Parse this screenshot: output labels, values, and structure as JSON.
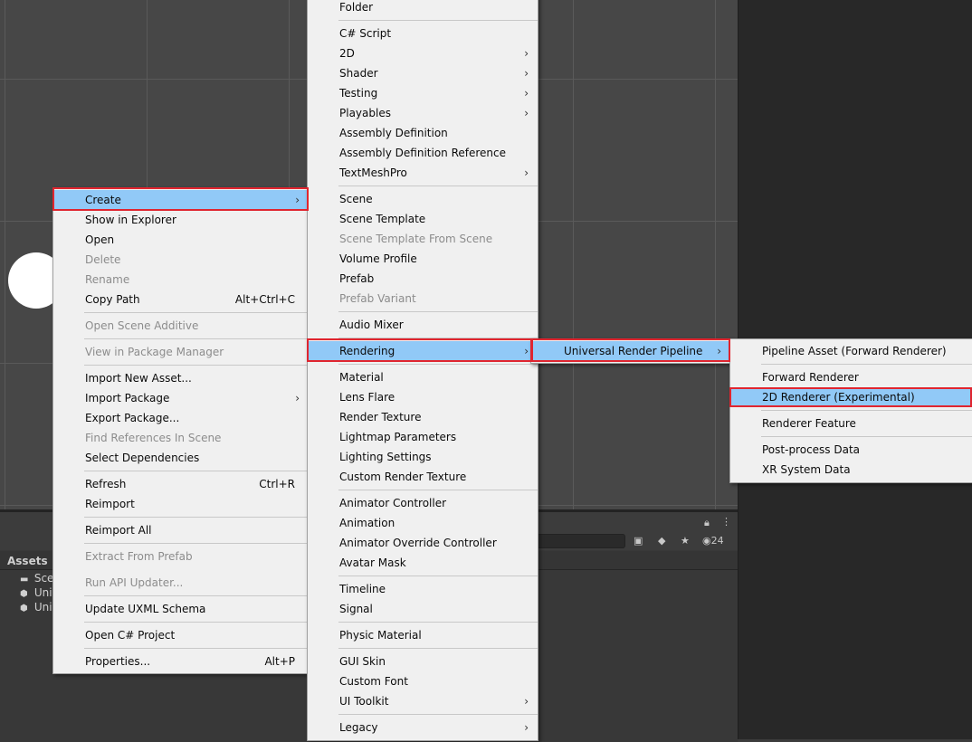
{
  "project_panel": {
    "assets_label": "Assets",
    "hidden_count": "24",
    "tree_items": [
      {
        "label": "Sce",
        "icon": "folder-icon"
      },
      {
        "label": "Uni",
        "icon": "asset-icon"
      },
      {
        "label": "Uni",
        "icon": "asset-icon"
      }
    ]
  },
  "context_menu": {
    "items": [
      {
        "label": "Create",
        "submenu": true,
        "highlighted": true
      },
      {
        "label": "Show in Explorer"
      },
      {
        "label": "Open"
      },
      {
        "label": "Delete",
        "disabled": true
      },
      {
        "label": "Rename",
        "disabled": true
      },
      {
        "label": "Copy Path",
        "shortcut": "Alt+Ctrl+C"
      },
      {
        "label": "Open Scene Additive",
        "disabled": true
      },
      {
        "label": "View in Package Manager",
        "disabled": true
      },
      {
        "label": "Import New Asset..."
      },
      {
        "label": "Import Package",
        "submenu": true
      },
      {
        "label": "Export Package..."
      },
      {
        "label": "Find References In Scene",
        "disabled": true
      },
      {
        "label": "Select Dependencies"
      },
      {
        "label": "Refresh",
        "shortcut": "Ctrl+R"
      },
      {
        "label": "Reimport"
      },
      {
        "label": "Reimport All"
      },
      {
        "label": "Extract From Prefab",
        "disabled": true
      },
      {
        "label": "Run API Updater...",
        "disabled": true
      },
      {
        "label": "Update UXML Schema"
      },
      {
        "label": "Open C# Project"
      },
      {
        "label": "Properties...",
        "shortcut": "Alt+P"
      }
    ]
  },
  "create_menu": {
    "items": [
      {
        "label": "Folder"
      },
      {
        "label": "C# Script"
      },
      {
        "label": "2D",
        "submenu": true
      },
      {
        "label": "Shader",
        "submenu": true
      },
      {
        "label": "Testing",
        "submenu": true
      },
      {
        "label": "Playables",
        "submenu": true
      },
      {
        "label": "Assembly Definition"
      },
      {
        "label": "Assembly Definition Reference"
      },
      {
        "label": "TextMeshPro",
        "submenu": true
      },
      {
        "label": "Scene"
      },
      {
        "label": "Scene Template"
      },
      {
        "label": "Scene Template From Scene",
        "disabled": true
      },
      {
        "label": "Volume Profile"
      },
      {
        "label": "Prefab"
      },
      {
        "label": "Prefab Variant",
        "disabled": true
      },
      {
        "label": "Audio Mixer"
      },
      {
        "label": "Rendering",
        "submenu": true,
        "highlighted": true
      },
      {
        "label": "Material"
      },
      {
        "label": "Lens Flare"
      },
      {
        "label": "Render Texture"
      },
      {
        "label": "Lightmap Parameters"
      },
      {
        "label": "Lighting Settings"
      },
      {
        "label": "Custom Render Texture"
      },
      {
        "label": "Animator Controller"
      },
      {
        "label": "Animation"
      },
      {
        "label": "Animator Override Controller"
      },
      {
        "label": "Avatar Mask"
      },
      {
        "label": "Timeline"
      },
      {
        "label": "Signal"
      },
      {
        "label": "Physic Material"
      },
      {
        "label": "GUI Skin"
      },
      {
        "label": "Custom Font"
      },
      {
        "label": "UI Toolkit",
        "submenu": true
      },
      {
        "label": "Legacy",
        "submenu": true
      }
    ]
  },
  "rendering_menu": {
    "items": [
      {
        "label": "Universal Render Pipeline",
        "submenu": true,
        "highlighted": true
      }
    ]
  },
  "urp_menu": {
    "items": [
      {
        "label": "Pipeline Asset (Forward Renderer)"
      },
      {
        "label": "Forward Renderer"
      },
      {
        "label": "2D Renderer (Experimental)",
        "highlighted": true
      },
      {
        "label": "Renderer Feature"
      },
      {
        "label": "Post-process Data"
      },
      {
        "label": "XR System Data"
      }
    ]
  },
  "colors": {
    "highlight": "#91c9f7",
    "annotation_red": "#e0252f",
    "menu_bg": "#f0f0f0"
  }
}
